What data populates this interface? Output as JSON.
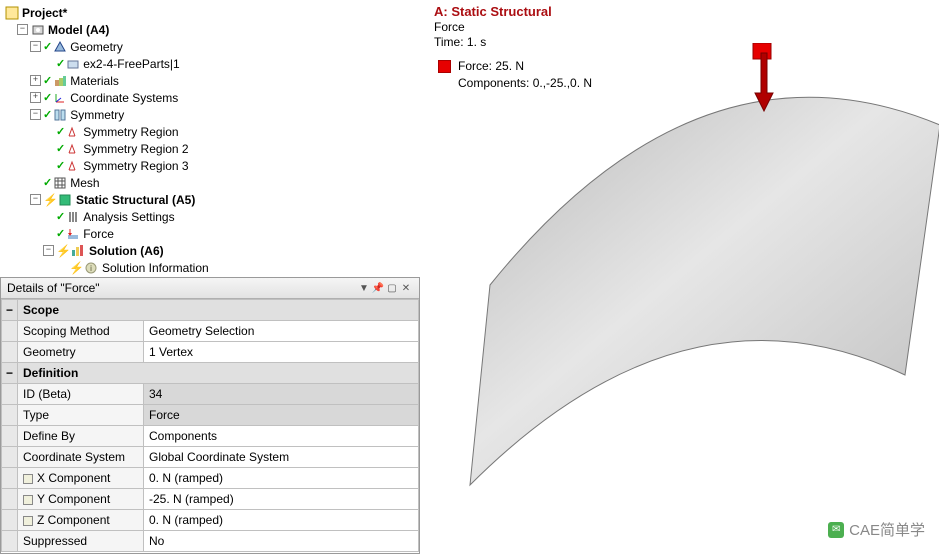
{
  "tree": {
    "root": "Project*",
    "model": "Model (A4)",
    "geometry": "Geometry",
    "parts": "ex2-4-FreeParts|1",
    "materials": "Materials",
    "coordsys": "Coordinate Systems",
    "symmetry": "Symmetry",
    "sym1": "Symmetry Region",
    "sym2": "Symmetry Region 2",
    "sym3": "Symmetry Region 3",
    "mesh": "Mesh",
    "static": "Static Structural (A5)",
    "analysis": "Analysis Settings",
    "force": "Force",
    "solution": "Solution (A6)",
    "solinfo": "Solution Information"
  },
  "details": {
    "title": "Details of \"Force\"",
    "sections": {
      "scope": "Scope",
      "definition": "Definition"
    },
    "rows": {
      "scoping_method": {
        "name": "Scoping Method",
        "value": "Geometry Selection"
      },
      "geometry": {
        "name": "Geometry",
        "value": "1 Vertex"
      },
      "id": {
        "name": "ID (Beta)",
        "value": "34"
      },
      "type": {
        "name": "Type",
        "value": "Force"
      },
      "define_by": {
        "name": "Define By",
        "value": "Components"
      },
      "coord_sys": {
        "name": "Coordinate System",
        "value": "Global Coordinate System"
      },
      "x": {
        "name": "X Component",
        "value": "0. N  (ramped)"
      },
      "y": {
        "name": "Y Component",
        "value": "-25. N  (ramped)"
      },
      "z": {
        "name": "Z Component",
        "value": "0. N  (ramped)"
      },
      "suppressed": {
        "name": "Suppressed",
        "value": "No"
      }
    }
  },
  "viewport": {
    "title": "A: Static Structural",
    "subtitle1": "Force",
    "subtitle2": "Time: 1. s",
    "legend_force": "Force: 25. N",
    "legend_components": "Components: 0.,-25.,0. N"
  },
  "watermark": "CAE简单学"
}
